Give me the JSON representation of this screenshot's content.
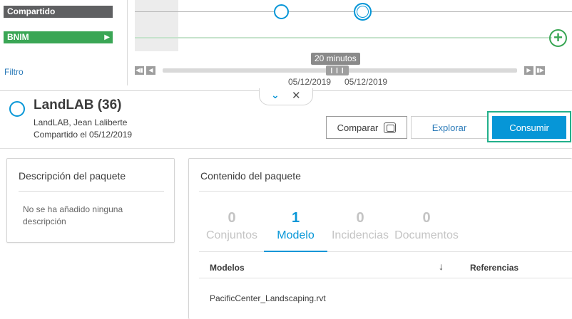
{
  "timeline": {
    "tracks": [
      {
        "label": "Compartido"
      },
      {
        "label": "BNIM"
      }
    ],
    "filter_label": "Filtro",
    "tooltip": "20 minutos",
    "date_left": "05/12/2019",
    "date_right": "05/12/2019"
  },
  "package": {
    "title": "LandLAB (36)",
    "authors": "LandLAB, Jean Laliberte",
    "shared": "Compartido el 05/12/2019"
  },
  "actions": {
    "compare": "Comparar",
    "explore": "Explorar",
    "consume": "Consumir"
  },
  "description_panel": {
    "title": "Descripción del paquete",
    "empty_text": "No se ha añadido ninguna descripción"
  },
  "content_panel": {
    "title": "Contenido del paquete",
    "tabs": [
      {
        "count": "0",
        "label": "Conjuntos"
      },
      {
        "count": "1",
        "label": "Modelo"
      },
      {
        "count": "0",
        "label": "Incidencias"
      },
      {
        "count": "0",
        "label": "Documentos"
      }
    ],
    "active_tab": "Modelo",
    "columns": {
      "models": "Modelos",
      "references": "Referencias"
    },
    "rows": [
      {
        "model": "PacificCenter_Landscaping.rvt"
      }
    ]
  },
  "colors": {
    "accent": "#0696d7",
    "shared_track": "#5f6062",
    "bnim_track": "#3aa655",
    "highlight": "#22b08b"
  }
}
